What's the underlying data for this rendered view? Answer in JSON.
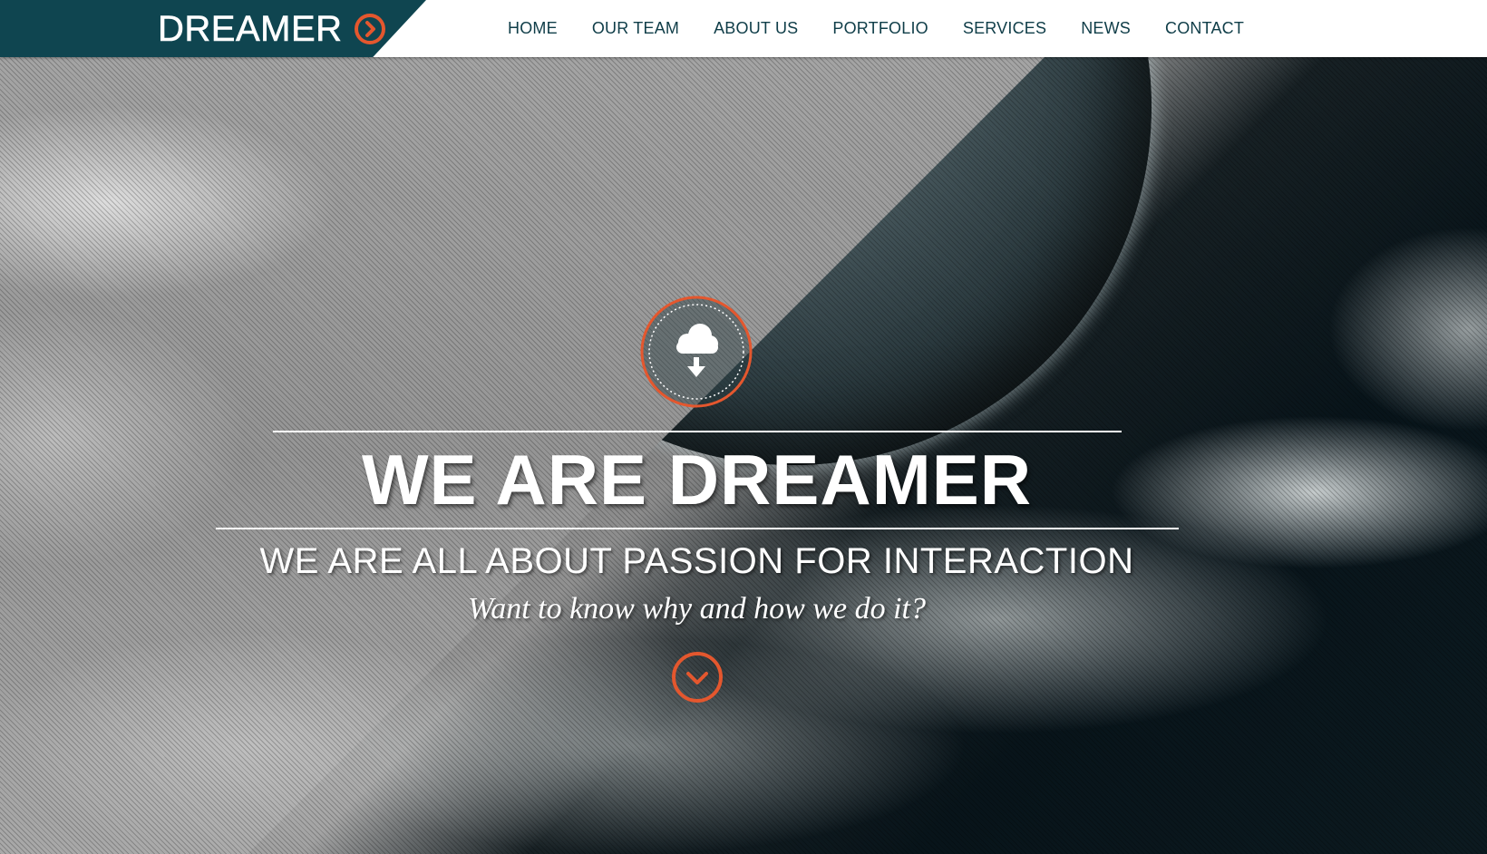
{
  "header": {
    "logo_text": "DREAMER",
    "logo_icon": "chevron-right-circle-icon",
    "nav": [
      {
        "label": "HOME"
      },
      {
        "label": "OUR TEAM"
      },
      {
        "label": "ABOUT US"
      },
      {
        "label": "PORTFOLIO"
      },
      {
        "label": "SERVICES"
      },
      {
        "label": "NEWS"
      },
      {
        "label": "CONTACT"
      }
    ]
  },
  "hero": {
    "badge_icon": "cloud-download-icon",
    "headline": "WE ARE DREAMER",
    "subheadline": "WE ARE ALL ABOUT PASSION FOR INTERACTION",
    "tagline": "Want to know why and how we do it?",
    "scroll_icon": "chevron-down-circle-icon"
  },
  "colors": {
    "brand_dark": "#0f4550",
    "accent": "#e4572e",
    "nav_text": "#0f3d48",
    "hero_text": "#ffffff"
  }
}
